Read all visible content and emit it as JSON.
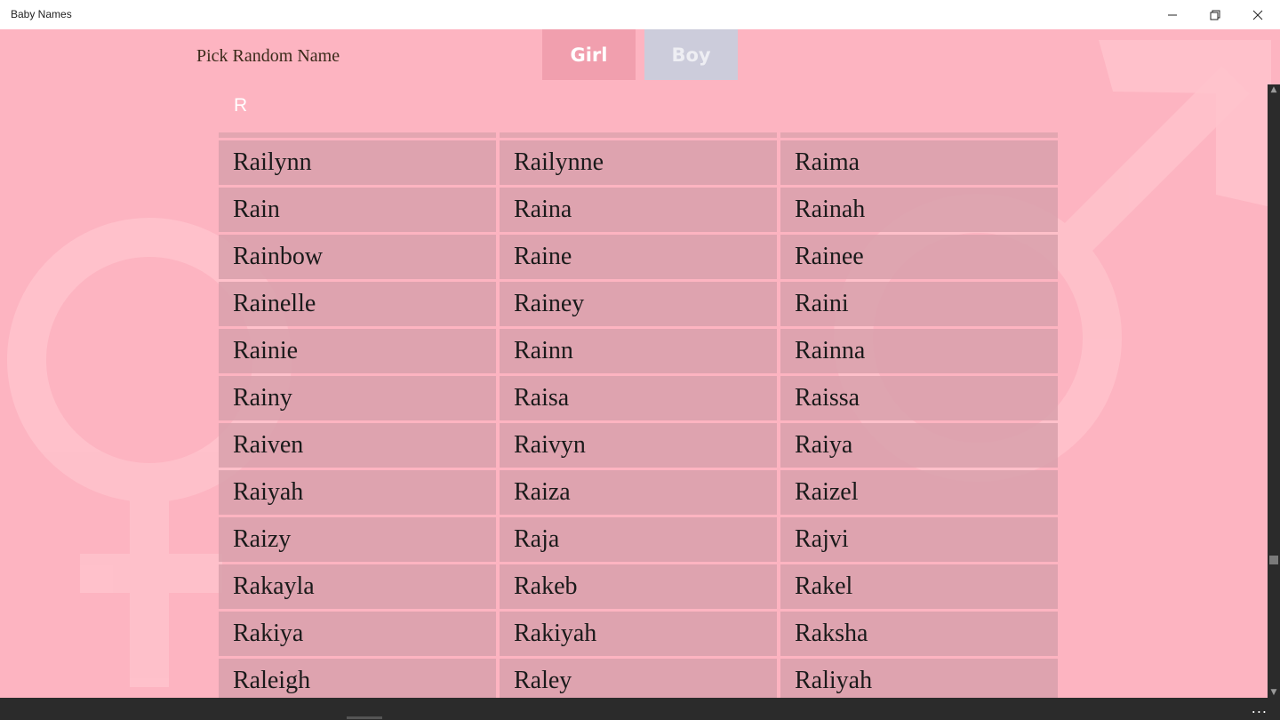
{
  "window": {
    "title": "Baby Names"
  },
  "toolbar": {
    "random_label": "Pick Random Name",
    "girl_label": "Girl",
    "boy_label": "Boy"
  },
  "filter": {
    "letter": "R"
  },
  "names": [
    [
      "Railynn",
      "Railynne",
      "Raima"
    ],
    [
      "Rain",
      "Raina",
      "Rainah"
    ],
    [
      "Rainbow",
      "Raine",
      "Rainee"
    ],
    [
      "Rainelle",
      "Rainey",
      "Raini"
    ],
    [
      "Rainie",
      "Rainn",
      "Rainna"
    ],
    [
      "Rainy",
      "Raisa",
      "Raissa"
    ],
    [
      "Raiven",
      "Raivyn",
      "Raiya"
    ],
    [
      "Raiyah",
      "Raiza",
      "Raizel"
    ],
    [
      "Raizy",
      "Raja",
      "Rajvi"
    ],
    [
      "Rakayla",
      "Rakeb",
      "Rakel"
    ],
    [
      "Rakiya",
      "Rakiyah",
      "Raksha"
    ],
    [
      "Raleigh",
      "Raley",
      "Raliyah"
    ]
  ],
  "appbar": {
    "more_label": "..."
  },
  "colors": {
    "background": "#fdb4c1",
    "girl_button": "#f19fae",
    "boy_button": "#ccccdb",
    "cell": "#d8a0ac"
  }
}
